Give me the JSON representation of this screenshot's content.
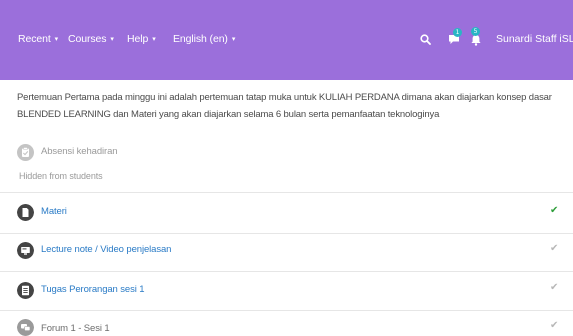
{
  "nav": {
    "items": [
      {
        "label": "Recent"
      },
      {
        "label": "Courses"
      },
      {
        "label": "Help"
      },
      {
        "label": "English (en)"
      }
    ],
    "caret": "▾",
    "message_badge": "1",
    "notification_badge": "5",
    "user": "Sunardi Staff iSLS - I"
  },
  "summary": {
    "text": "Pertemuan Pertama pada minggu ini adalah pertemuan tatap muka untuk KULIAH PERDANA dimana akan diajarkan konsep dasar BLENDED LEARNING dan Materi yang akan diajarkan selama 6 bulan serta pemanfaatan teknologinya"
  },
  "activities": [
    {
      "title": "Absensi kehadiran",
      "note": "Hidden from students",
      "icon": "attendance-icon",
      "check": ""
    },
    {
      "title": "Materi",
      "icon": "file-icon",
      "check": "✔",
      "check_color": "#2e9e3a"
    },
    {
      "title": "Lecture note / Video penjelasan",
      "icon": "url-icon",
      "check": "✔",
      "check_color": "#b8b8b8"
    },
    {
      "title": "Tugas Perorangan sesi 1",
      "icon": "assignment-icon",
      "check": "✔",
      "check_color": "#b8b8b8"
    },
    {
      "title": "Forum 1 - Sesi 1",
      "icon": "forum-icon",
      "check": "✔",
      "check_color": "#b8b8b8"
    }
  ],
  "colors": {
    "navbar": "#9b6fdb",
    "link": "#2a7bc6",
    "badge": "#29b6c4"
  }
}
